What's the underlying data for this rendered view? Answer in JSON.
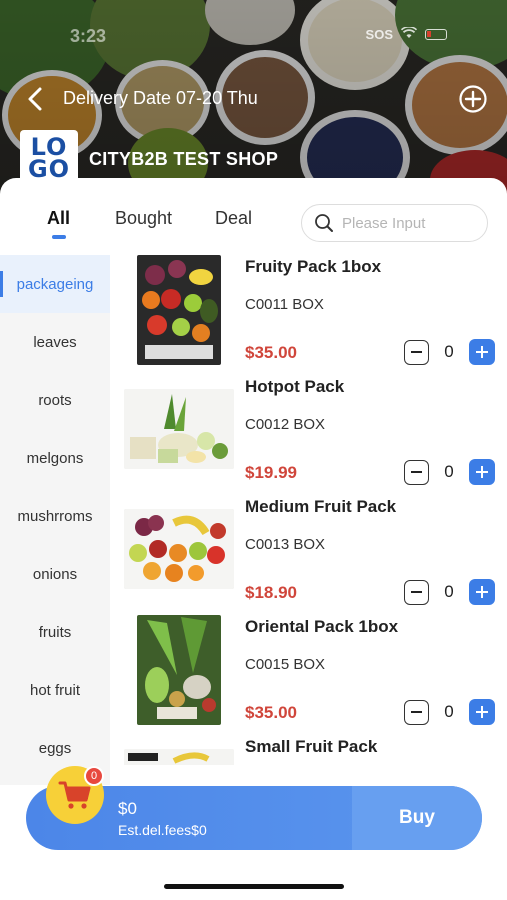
{
  "status_bar": {
    "time": "3:23",
    "network": "SOS"
  },
  "header": {
    "back_icon": "chevron-left-icon",
    "delivery_label": "Delivery Date 07-20 Thu",
    "add_icon": "plus-circle-icon",
    "logo_top": "LO",
    "logo_bottom": "GO",
    "shop_name": "CITYB2B TEST SHOP"
  },
  "tabs": [
    {
      "label": "All",
      "active": true
    },
    {
      "label": "Bought",
      "active": false
    },
    {
      "label": "Deal",
      "active": false
    }
  ],
  "search": {
    "placeholder": "Please Input",
    "icon": "search-icon"
  },
  "categories": [
    {
      "label": "packageing",
      "active": true
    },
    {
      "label": "leaves"
    },
    {
      "label": "roots"
    },
    {
      "label": "melgons"
    },
    {
      "label": "mushrroms"
    },
    {
      "label": "onions"
    },
    {
      "label": "fruits"
    },
    {
      "label": "hot fruit"
    },
    {
      "label": "eggs"
    }
  ],
  "products": [
    {
      "name": "Fruity Pack 1box",
      "code": "C0011 BOX",
      "price": "$35.00",
      "qty": "0"
    },
    {
      "name": "Hotpot Pack",
      "code": "C0012 BOX",
      "price": "$19.99",
      "qty": "0"
    },
    {
      "name": "Medium Fruit Pack",
      "code": "C0013 BOX",
      "price": "$18.90",
      "qty": "0"
    },
    {
      "name": "Oriental Pack 1box",
      "code": "C0015 BOX",
      "price": "$35.00",
      "qty": "0"
    },
    {
      "name": "Small Fruit Pack",
      "code": "",
      "price": "",
      "qty": ""
    }
  ],
  "cart": {
    "icon": "shopping-cart-icon",
    "badge_count": "0",
    "total": "$0",
    "fees": "Est.del.fees$0",
    "buy_label": "Buy"
  },
  "colors": {
    "accent": "#3c7de6",
    "price": "#d0463b",
    "cart_icon_bg": "#f7d038",
    "badge": "#e8483f"
  }
}
